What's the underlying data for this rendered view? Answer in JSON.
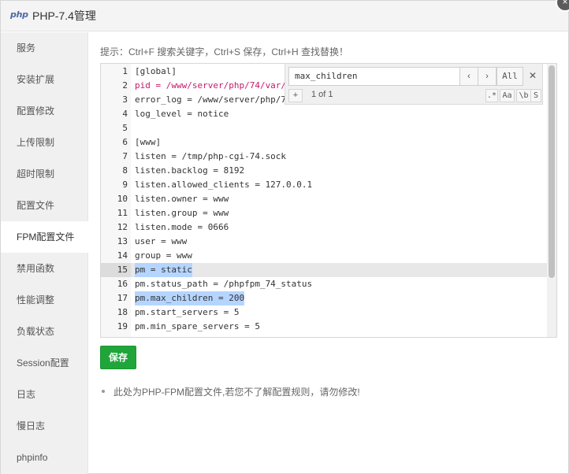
{
  "window": {
    "logo_text": "php",
    "title": "PHP-7.4管理",
    "close_glyph": "×"
  },
  "sidebar": {
    "items": [
      {
        "label": "服务",
        "active": false
      },
      {
        "label": "安装扩展",
        "active": false
      },
      {
        "label": "配置修改",
        "active": false
      },
      {
        "label": "上传限制",
        "active": false
      },
      {
        "label": "超时限制",
        "active": false
      },
      {
        "label": "配置文件",
        "active": false
      },
      {
        "label": "FPM配置文件",
        "active": true
      },
      {
        "label": "禁用函数",
        "active": false
      },
      {
        "label": "性能调整",
        "active": false
      },
      {
        "label": "负载状态",
        "active": false
      },
      {
        "label": "Session配置",
        "active": false
      },
      {
        "label": "日志",
        "active": false
      },
      {
        "label": "慢日志",
        "active": false
      },
      {
        "label": "phpinfo",
        "active": false
      }
    ]
  },
  "main": {
    "tip": "提示：Ctrl+F 搜索关键字，Ctrl+S 保存，Ctrl+H 查找替换！",
    "editor": {
      "lines": [
        {
          "n": "1",
          "text": "[global]"
        },
        {
          "n": "2",
          "text": "pid = /www/server/php/74/var/"
        },
        {
          "n": "3",
          "text": "error_log = /www/server/php/7"
        },
        {
          "n": "4",
          "text": "log_level = notice"
        },
        {
          "n": "5",
          "text": ""
        },
        {
          "n": "6",
          "text": "[www]"
        },
        {
          "n": "7",
          "text": "listen = /tmp/php-cgi-74.sock"
        },
        {
          "n": "8",
          "text": "listen.backlog = 8192"
        },
        {
          "n": "9",
          "text": "listen.allowed_clients = 127.0.0.1"
        },
        {
          "n": "10",
          "text": "listen.owner = www"
        },
        {
          "n": "11",
          "text": "listen.group = www"
        },
        {
          "n": "12",
          "text": "listen.mode = 0666"
        },
        {
          "n": "13",
          "text": "user = www"
        },
        {
          "n": "14",
          "text": "group = www"
        },
        {
          "n": "15",
          "text": "pm = static"
        },
        {
          "n": "16",
          "text": "pm.status_path = /phpfpm_74_status"
        },
        {
          "n": "17",
          "text": "pm.max_children = 200"
        },
        {
          "n": "18",
          "text": "pm.start_servers = 5"
        },
        {
          "n": "19",
          "text": "pm.min_spare_servers = 5"
        }
      ],
      "search": {
        "value": "max_children",
        "prev_glyph": "‹",
        "next_glyph": "›",
        "all_label": "All",
        "close_glyph": "✕",
        "expand_glyph": "+",
        "match_count": "1 of 1",
        "opt_regex": ".*",
        "opt_case": "Aa",
        "opt_word": "\\b",
        "opt_selection": "S"
      }
    },
    "save_label": "保存",
    "notes": [
      "此处为PHP-FPM配置文件,若您不了解配置规则，请勿修改!"
    ]
  },
  "colors": {
    "accent_green": "#20a53a",
    "selection": "#b5d5ff",
    "sidebar_bg": "#f0f0f0"
  }
}
